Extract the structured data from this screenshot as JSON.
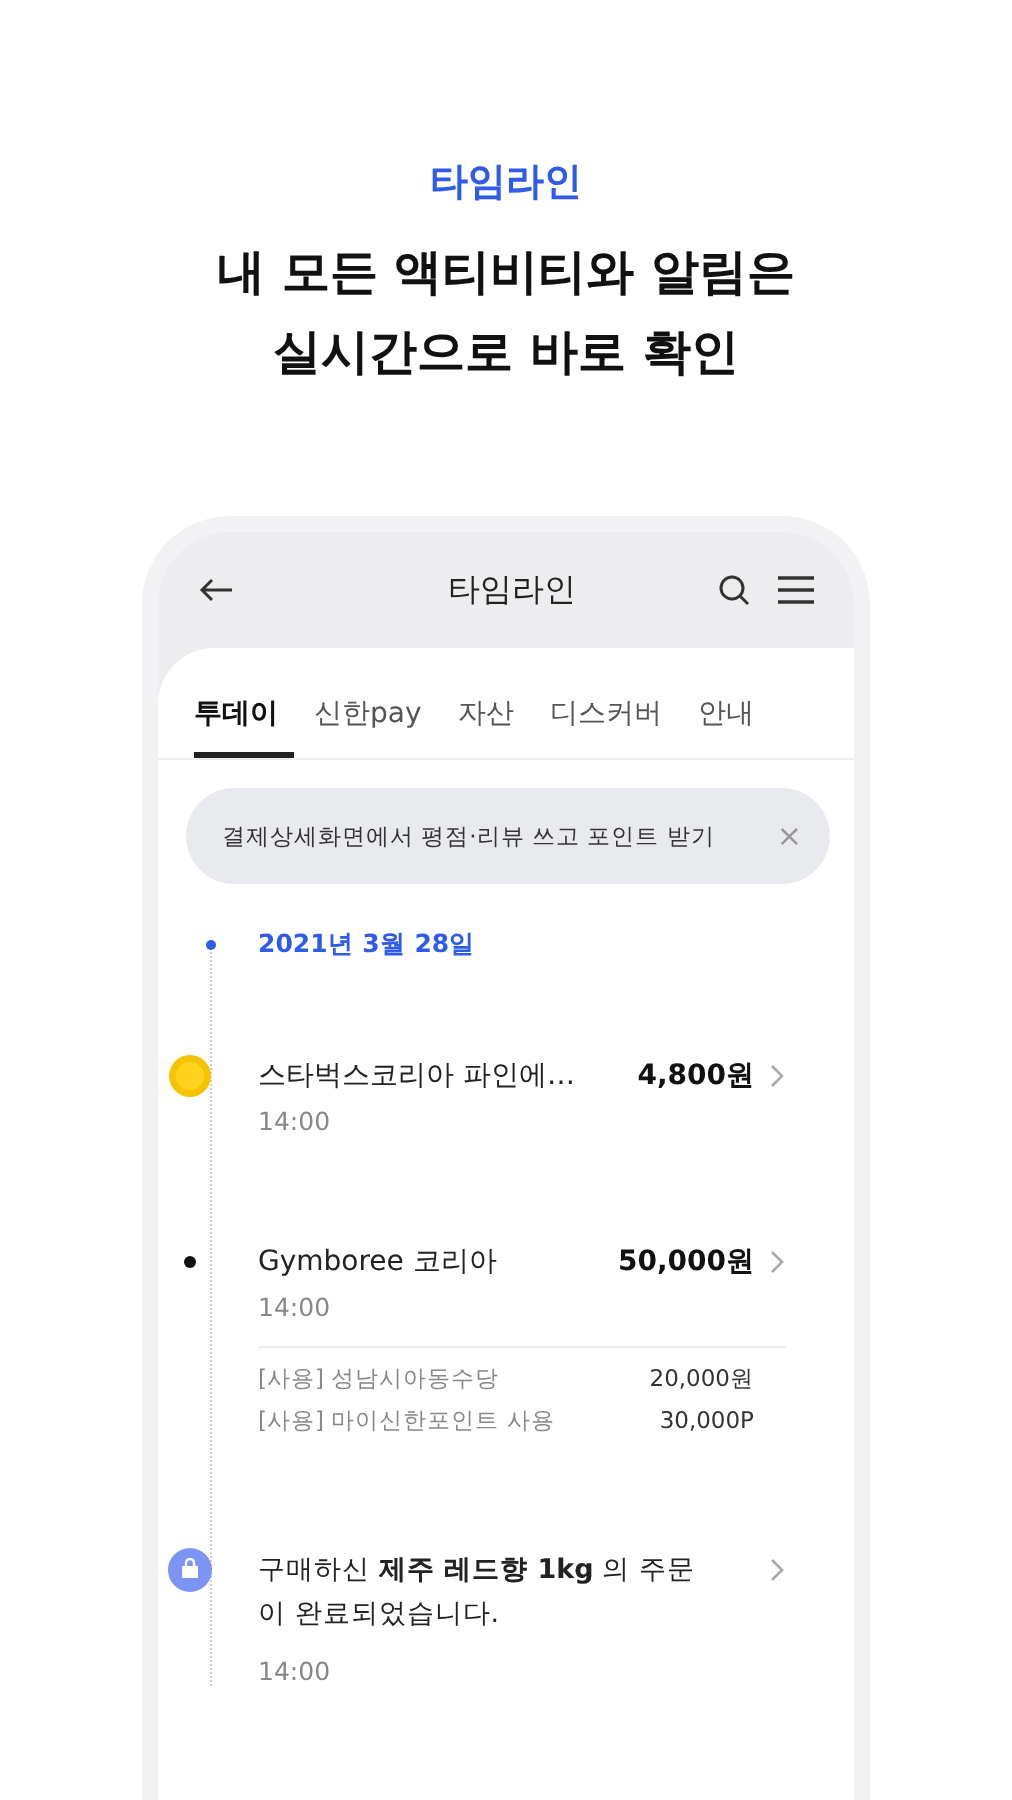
{
  "promo": {
    "eyebrow": "타임라인",
    "headline": [
      "내 모든 액티비티와 알림은",
      "실시간으로 바로 확인"
    ]
  },
  "header": {
    "title": "타임라인"
  },
  "tabs": [
    {
      "label": "투데이",
      "selected": true
    },
    {
      "label": "신한pay",
      "selected": false
    },
    {
      "label": "자산",
      "selected": false
    },
    {
      "label": "디스커버",
      "selected": false
    },
    {
      "label": "안내",
      "selected": false
    }
  ],
  "banner": {
    "text": "결제상세화면에서 평점·리뷰 쓰고 포인트 받기",
    "close": "×"
  },
  "date": "2021년 3월 28일",
  "items": [
    {
      "kind": "coin",
      "title": "스타벅스코리아 파인에…",
      "amount": "4,800원",
      "time": "14:00"
    },
    {
      "kind": "dot",
      "title": "Gymboree 코리아",
      "amount": "50,000원",
      "time": "14:00",
      "details": [
        {
          "label": "[사용] 성남시아동수당",
          "value": "20,000원"
        },
        {
          "label": "[사용] 마이신한포인트 사용",
          "value": "30,000P"
        }
      ]
    },
    {
      "kind": "bag",
      "title": "구매하신 **제주 레드향 1kg** 의 주문이 완료되었습니다.",
      "time": "14:00"
    }
  ]
}
